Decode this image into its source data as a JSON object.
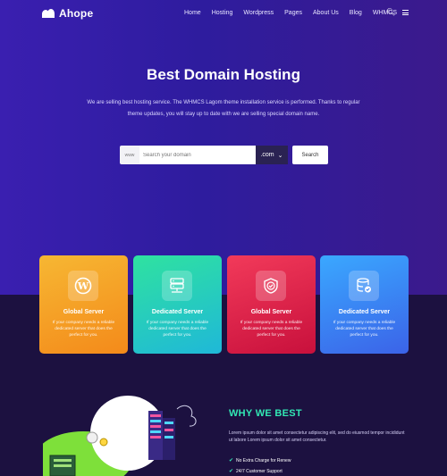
{
  "brand": {
    "name": "Ahope"
  },
  "nav": {
    "items": [
      "Home",
      "Hosting",
      "Wordpress",
      "Pages",
      "About Us",
      "Blog",
      "WHMCS"
    ],
    "icons": [
      "search-icon",
      "menu-icon"
    ]
  },
  "hero": {
    "title": "Best Domain Hosting",
    "subtitle_line1": "We are selling best hosting service. The WHMCS Lagom theme installation service is performed. Thanks to regular",
    "subtitle_line2": "theme updates, you will stay up to date with we are selling special domain name."
  },
  "search": {
    "prefix": "www",
    "placeholder": "Search your domain",
    "tld": ".com",
    "button": "Search"
  },
  "cards": [
    {
      "title": "Global Server",
      "text": "If your company needs a reliable dedicated server that does the perfect for you.",
      "icon": "wordpress-icon",
      "color": "#f4a126"
    },
    {
      "title": "Dedicated Server",
      "text": "If your company needs a reliable dedicated server that does the perfect for you.",
      "icon": "server-icon",
      "color": "#25cbb8"
    },
    {
      "title": "Global Server",
      "text": "If your company needs a reliable dedicated server that does the perfect for you.",
      "icon": "shield-check-icon",
      "color": "#e12549"
    },
    {
      "title": "Dedicated Server",
      "text": "If your company needs a reliable dedicated server that does the perfect for you.",
      "icon": "database-check-icon",
      "color": "#3a85f4"
    }
  ],
  "why": {
    "title": "WHY WE BEST",
    "text": "Lorem ipsum dolor sit amet consectetur adipiscing elit, sed do eiusmod tempor incididunt ut labore Lorem ipsum dolor sit amet consectetur.",
    "items": [
      "No Extra Charge for Renew",
      "24/7 Customer Support"
    ]
  },
  "colors": {
    "accent": "#32e8b4",
    "hero_bg": "#2e1c9e",
    "dark_bg": "#1c1140"
  }
}
